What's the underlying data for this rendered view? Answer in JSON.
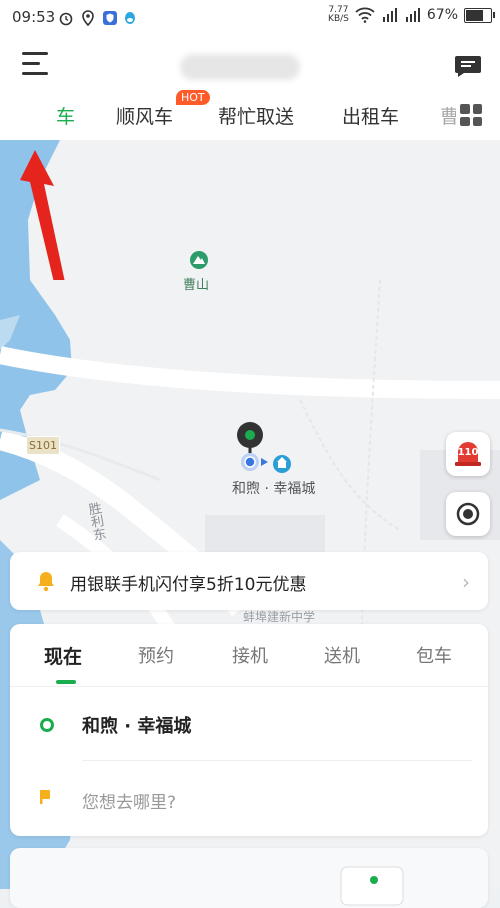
{
  "status_bar": {
    "time": "09:53",
    "net_speed_value": "7.77",
    "net_speed_unit": "KB/S",
    "battery_percent_text": "67%",
    "battery_level": 0.67
  },
  "header": {
    "tabs": [
      {
        "label": "车",
        "active": true
      },
      {
        "label": "顺风车",
        "badge": "HOT"
      },
      {
        "label": "帮忙取送"
      },
      {
        "label": "出租车"
      },
      {
        "label": "曹"
      }
    ]
  },
  "map": {
    "road_label": "S101",
    "poi_mountain": "曹山",
    "street_text": "胜利东",
    "school_text": "蚌埠建新中学",
    "current_location": "和煦 · 幸福城",
    "emergency_label": "110"
  },
  "promo": {
    "text": "用银联手机闪付享5折10元优惠"
  },
  "booking": {
    "mode_tabs": [
      "现在",
      "预约",
      "接机",
      "送机",
      "包车"
    ],
    "from": "和煦 · 幸福城",
    "to_placeholder": "您想去哪里?"
  },
  "colors": {
    "accent": "#1aad4e",
    "hot_badge": "#ff5a2a",
    "water": "#8fc3ea",
    "annotation_arrow": "#e5241d"
  }
}
